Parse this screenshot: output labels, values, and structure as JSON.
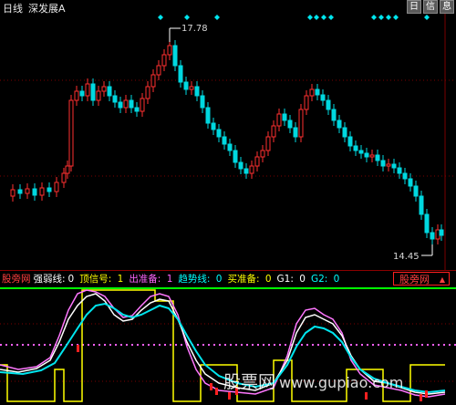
{
  "header": {
    "period_label": "日线",
    "stock_name": "深发展A"
  },
  "toolbar": {
    "btn1": "日",
    "btn2": "信",
    "btn3": "息"
  },
  "price_chart": {
    "high_label": "17.78",
    "low_label": "14.45"
  },
  "indicator": {
    "name": "股旁网",
    "items": [
      {
        "label": "强弱线:",
        "value": "0"
      },
      {
        "label": "顶信号:",
        "value": "1"
      },
      {
        "label": "出准备:",
        "value": "1"
      },
      {
        "label": "趋势线:",
        "value": "0"
      },
      {
        "label": "买准备:",
        "value": "0"
      },
      {
        "label": "G1:",
        "value": "0"
      },
      {
        "label": "G2:",
        "value": "0"
      }
    ],
    "selector": "股旁网"
  },
  "watermark": {
    "text": "股票网",
    "url": "www.gupiao.com"
  },
  "colors": {
    "up": "#ff3030",
    "down": "#00d8e0",
    "bg": "#000000"
  }
}
